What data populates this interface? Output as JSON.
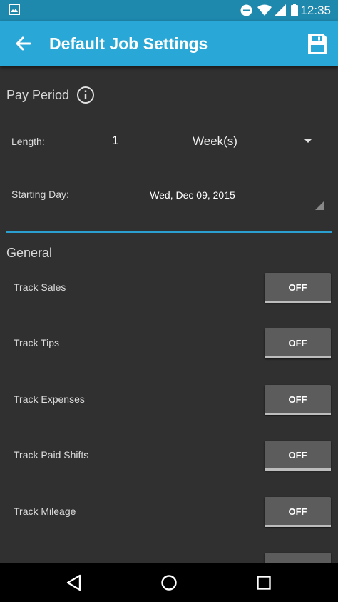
{
  "status_bar": {
    "time": "12:35"
  },
  "app_bar": {
    "title": "Default Job Settings"
  },
  "pay_period": {
    "heading": "Pay Period",
    "length_label": "Length:",
    "length_value": "1",
    "length_unit": "Week(s)",
    "starting_day_label": "Starting Day:",
    "starting_day_value": "Wed, Dec 09, 2015"
  },
  "general": {
    "heading": "General",
    "toggles": [
      {
        "label": "Track Sales",
        "state": "OFF"
      },
      {
        "label": "Track Tips",
        "state": "OFF"
      },
      {
        "label": "Track Expenses",
        "state": "OFF"
      },
      {
        "label": "Track Paid Shifts",
        "state": "OFF"
      },
      {
        "label": "Track Mileage",
        "state": "OFF"
      }
    ]
  },
  "colors": {
    "primary": "#29a7d6",
    "primary_dark": "#1e88ad",
    "accent_line": "#2a9fd0",
    "background": "#303030"
  }
}
